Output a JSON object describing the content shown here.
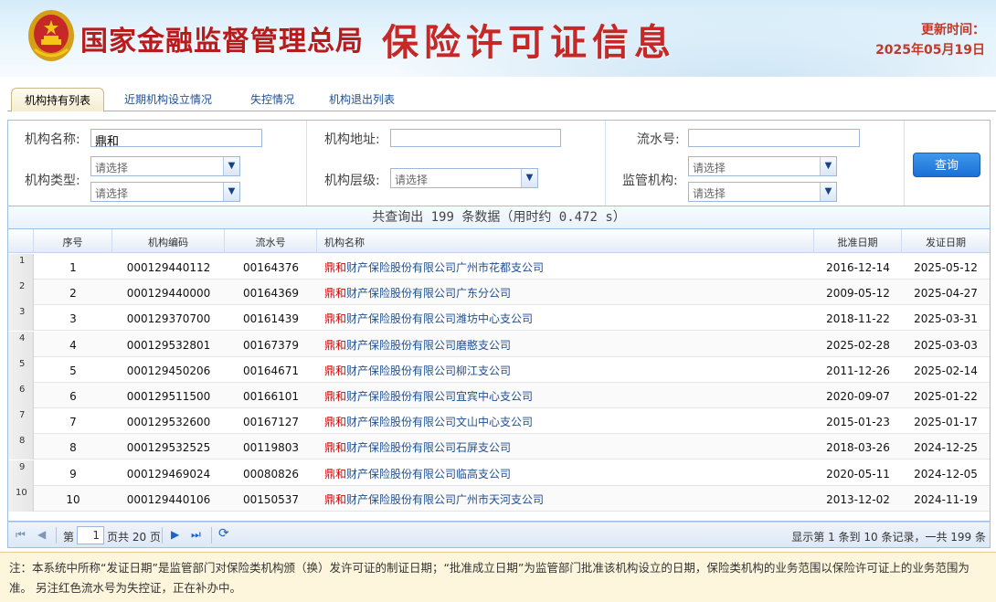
{
  "header": {
    "agency": "国家金融监督管理总局",
    "system_title": "保险许可证信息",
    "update_label": "更新时间：",
    "update_date": "2025年05月19日"
  },
  "tabs": [
    {
      "label": "机构持有列表",
      "active": true
    },
    {
      "label": "近期机构设立情况",
      "active": false
    },
    {
      "label": "失控情况",
      "active": false
    },
    {
      "label": "机构退出列表",
      "active": false
    }
  ],
  "search": {
    "org_name_label": "机构名称:",
    "org_name_value": "鼎和",
    "org_address_label": "机构地址:",
    "org_address_value": "",
    "serial_label": "流水号:",
    "serial_value": "",
    "org_type_label": "机构类型:",
    "org_level_label": "机构层级:",
    "supervisor_label": "监管机构:",
    "select_placeholder": "请选择",
    "query_button": "查询"
  },
  "summary": "共查询出 199 条数据（用时约 0.472 s）",
  "table": {
    "columns": [
      "序号",
      "机构编码",
      "流水号",
      "机构名称",
      "批准日期",
      "发证日期"
    ],
    "highlight": "鼎和",
    "rows": [
      {
        "rownum": "1",
        "seq": "1",
        "code": "000129440112",
        "serial": "00164376",
        "name": "财产保险股份有限公司广州市花都支公司",
        "approve": "2016-12-14",
        "issue": "2025-05-12"
      },
      {
        "rownum": "2",
        "seq": "2",
        "code": "000129440000",
        "serial": "00164369",
        "name": "财产保险股份有限公司广东分公司",
        "approve": "2009-05-12",
        "issue": "2025-04-27"
      },
      {
        "rownum": "3",
        "seq": "3",
        "code": "000129370700",
        "serial": "00161439",
        "name": "财产保险股份有限公司潍坊中心支公司",
        "approve": "2018-11-22",
        "issue": "2025-03-31"
      },
      {
        "rownum": "4",
        "seq": "4",
        "code": "000129532801",
        "serial": "00167379",
        "name": "财产保险股份有限公司磨憨支公司",
        "approve": "2025-02-28",
        "issue": "2025-03-03"
      },
      {
        "rownum": "5",
        "seq": "5",
        "code": "000129450206",
        "serial": "00164671",
        "name": "财产保险股份有限公司柳江支公司",
        "approve": "2011-12-26",
        "issue": "2025-02-14"
      },
      {
        "rownum": "6",
        "seq": "6",
        "code": "000129511500",
        "serial": "00166101",
        "name": "财产保险股份有限公司宜宾中心支公司",
        "approve": "2020-09-07",
        "issue": "2025-01-22"
      },
      {
        "rownum": "7",
        "seq": "7",
        "code": "000129532600",
        "serial": "00167127",
        "name": "财产保险股份有限公司文山中心支公司",
        "approve": "2015-01-23",
        "issue": "2025-01-17"
      },
      {
        "rownum": "8",
        "seq": "8",
        "code": "000129532525",
        "serial": "00119803",
        "name": "财产保险股份有限公司石屏支公司",
        "approve": "2018-03-26",
        "issue": "2024-12-25"
      },
      {
        "rownum": "9",
        "seq": "9",
        "code": "000129469024",
        "serial": "00080826",
        "name": "财产保险股份有限公司临高支公司",
        "approve": "2020-05-11",
        "issue": "2024-12-05"
      },
      {
        "rownum": "10",
        "seq": "10",
        "code": "000129440106",
        "serial": "00150537",
        "name": "财产保险股份有限公司广州市天河支公司",
        "approve": "2013-12-02",
        "issue": "2024-11-19"
      }
    ]
  },
  "pager": {
    "page_prefix": "第",
    "page_value": "1",
    "page_suffix": "页共 20 页",
    "display_info": "显示第 1 条到 10 条记录，一共 199 条"
  },
  "note": "注：本系统中所称“发证日期”是监管部门对保险类机构颁（换）发许可证的制证日期；“批准成立日期”为监管部门批准该机构设立的日期，保险类机构的业务范围以保险许可证上的业务范围为准。  另注红色流水号为失控证，正在补办中。",
  "colors": {
    "title_red": "#c62828",
    "link_blue": "#1f4f91",
    "highlight_red": "#d40000",
    "button_blue": "#1d6fd6"
  }
}
